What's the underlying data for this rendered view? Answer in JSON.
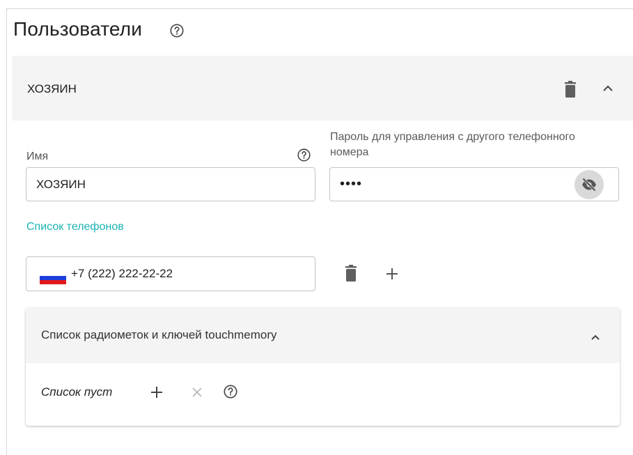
{
  "page": {
    "title": "Пользователи"
  },
  "user": {
    "header_name": "ХОЗЯИН",
    "name_label": "Имя",
    "name_value": "ХОЗЯИН",
    "password_label": "Пароль для управления с другого телефонного номера",
    "password_value": "••••"
  },
  "phones": {
    "heading": "Список телефонов",
    "items": [
      {
        "value": "+7 (222) 222-22-22",
        "country_flag": "russia-flag-icon"
      }
    ]
  },
  "radio_tags": {
    "title": "Список радиометок и ключей touchmemory",
    "empty_text": "Список пуст"
  },
  "colors": {
    "accent": "#1bb3b3",
    "header_bg": "#f4f4f4",
    "icon": "#616161",
    "flag_white": "#ffffff",
    "flag_blue": "#1c3fdc",
    "flag_red": "#e3171b"
  },
  "icons": {
    "title_help": "help-circle-icon",
    "delete": "trash-icon",
    "collapse": "chevron-up-icon",
    "visibility": "eye-off-icon",
    "add": "plus-icon",
    "remove": "close-icon"
  }
}
